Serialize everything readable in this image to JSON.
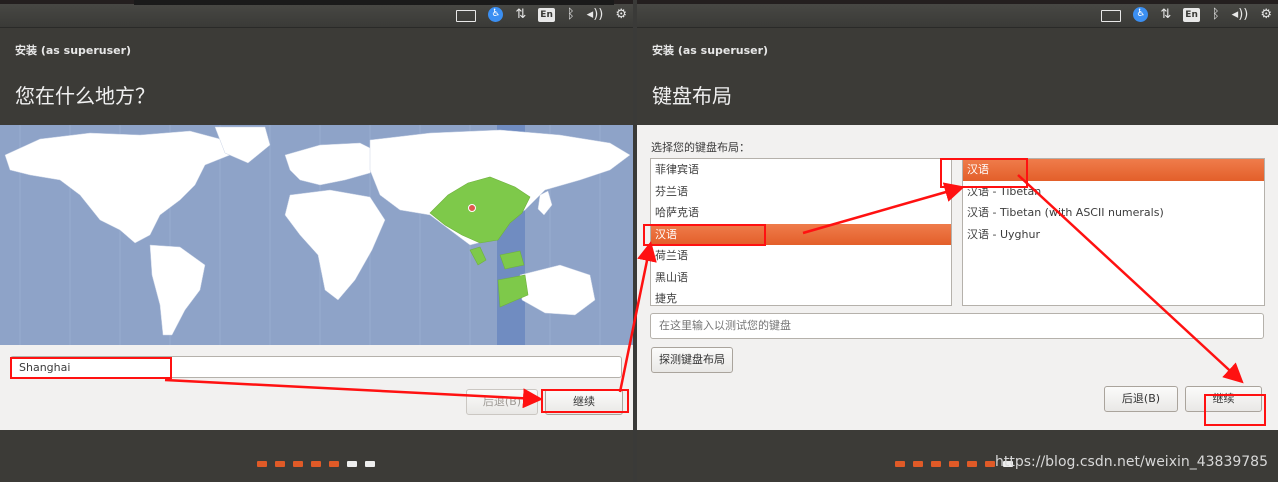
{
  "left": {
    "window_title": "安装 (as superuser)",
    "page_title": "您在什么地方？",
    "location_value": "Shanghai",
    "back_label": "后退(B)",
    "continue_label": "继续",
    "progress": {
      "total": 7,
      "done": 5
    }
  },
  "right": {
    "window_title": "安装 (as superuser)",
    "page_title": "键盘布局",
    "layout_prompt": "选择您的键盘布局：",
    "languages": [
      "菲律宾语",
      "芬兰语",
      "哈萨克语",
      "汉语",
      "荷兰语",
      "黑山语",
      "捷克"
    ],
    "selected_language_index": 3,
    "variants": [
      "汉语",
      "汉语 - Tibetan",
      "汉语 - Tibetan (with ASCII numerals)",
      "汉语 - Uyghur"
    ],
    "selected_variant_index": 0,
    "test_placeholder": "在这里输入以测试您的键盘",
    "detect_label": "探测键盘布局",
    "back_label": "后退(B)",
    "continue_label": "继续",
    "progress": {
      "total": 7,
      "done": 6
    }
  },
  "tray": {
    "icons": [
      "keyboard-icon",
      "accessibility-icon",
      "network-icon",
      "input-method-icon",
      "bluetooth-icon",
      "volume-icon",
      "settings-icon"
    ],
    "input_method": "En"
  },
  "watermark": "https://blog.csdn.net/weixin_43839785",
  "colors": {
    "accent": "#e05a27",
    "annotation": "#ff1111",
    "header": "#3c3b37",
    "land": "#ffffff",
    "land_selected": "#7ec94a",
    "ocean": "#8ea3c8"
  }
}
